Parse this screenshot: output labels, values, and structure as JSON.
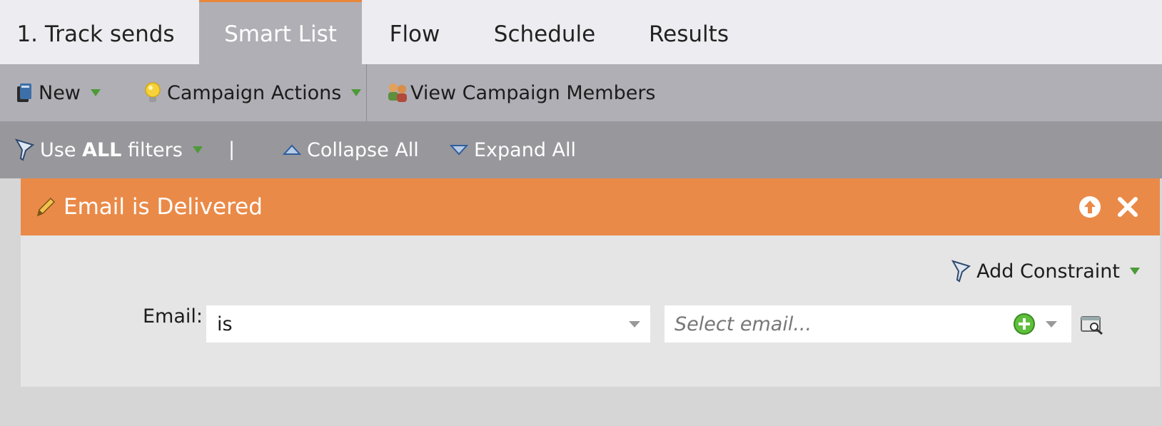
{
  "tabs": [
    {
      "label": "1. Track sends"
    },
    {
      "label": "Smart List"
    },
    {
      "label": "Flow"
    },
    {
      "label": "Schedule"
    },
    {
      "label": "Results"
    }
  ],
  "toolbar": {
    "new_label": "New",
    "campaign_actions_label": "Campaign Actions",
    "view_members_label": "View Campaign Members"
  },
  "filterbar": {
    "use_prefix": "Use",
    "use_bold": "ALL",
    "use_suffix": "filters",
    "separator": "|",
    "collapse_label": "Collapse All",
    "expand_label": "Expand All"
  },
  "filter": {
    "title": "Email is Delivered",
    "add_constraint_label": "Add Constraint",
    "email_label": "Email:",
    "operator_value": "is",
    "email_placeholder": "Select email..."
  },
  "colors": {
    "accent": "#ea8a48",
    "tab_active": "#b0afb5",
    "toolbar": "#b0afb5",
    "filterbar": "#98979c",
    "dropdown_marker": "#4d9a38"
  }
}
